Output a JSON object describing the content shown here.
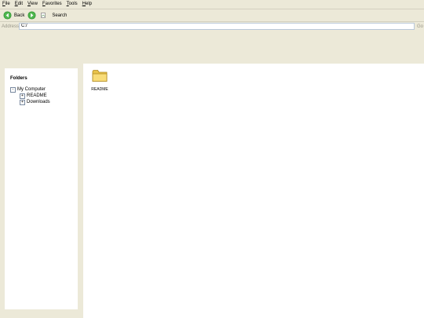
{
  "menu": [
    {
      "label": "File",
      "mnemonic": "F",
      "rest": "ile"
    },
    {
      "label": "Edit",
      "mnemonic": "E",
      "rest": "dit"
    },
    {
      "label": "View",
      "mnemonic": "V",
      "rest": "iew"
    },
    {
      "label": "Favorites",
      "mnemonic": "F",
      "rest": "avorites"
    },
    {
      "label": "Tools",
      "mnemonic": "T",
      "rest": "ools"
    },
    {
      "label": "Help",
      "mnemonic": "H",
      "rest": "elp"
    }
  ],
  "toolbar": {
    "back_label": "Back",
    "search_label": "Search",
    "back_icon": "back-arrow-icon",
    "forward_icon": "forward-arrow-icon",
    "search_icon": "search-icon"
  },
  "address": {
    "label": "Address",
    "value": "C:/",
    "go_label": "Go"
  },
  "folders": {
    "title": "Folders",
    "root": {
      "toggle": "-",
      "label": "My Computer"
    },
    "children": [
      {
        "toggle": "+",
        "label": "README"
      },
      {
        "toggle": "+",
        "label": "Downloads"
      }
    ]
  },
  "files": [
    {
      "name": "README",
      "icon": "folder-icon"
    }
  ],
  "colors": {
    "chrome": "#ece9d8",
    "green_icon": "#3a9a3a",
    "folder_yellow": "#f5d86b"
  }
}
